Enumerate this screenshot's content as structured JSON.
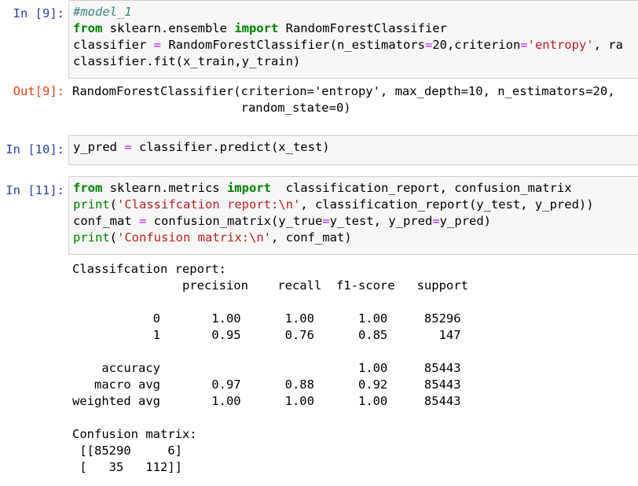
{
  "cells": [
    {
      "prompt": "In [9]:",
      "lines": [
        "#model_1",
        "from sklearn.ensemble import RandomForestClassifier",
        "classifier = RandomForestClassifier(n_estimators=20,criterion='entropy', ra",
        "classifier.fit(x_train,y_train)"
      ],
      "out_prompt": "Out[9]:",
      "output": "RandomForestClassifier(criterion='entropy', max_depth=10, n_estimators=20,\n                       random_state=0)"
    },
    {
      "prompt": "In [10]:",
      "lines": [
        "y_pred = classifier.predict(x_test)"
      ]
    },
    {
      "prompt": "In [11]:",
      "lines": [
        "from sklearn.metrics import  classification_report, confusion_matrix",
        "print('Classifcation report:\\n', classification_report(y_test, y_pred))",
        "conf_mat = confusion_matrix(y_true=y_test, y_pred=y_pred)",
        "print('Confusion matrix:\\n', conf_mat)"
      ],
      "stdout": "Classifcation report:\n               precision    recall  f1-score   support\n\n           0       1.00      1.00      1.00     85296\n           1       0.95      0.76      0.85       147\n\n    accuracy                           1.00     85443\n   macro avg       0.97      0.88      0.92     85443\nweighted avg       1.00      1.00      1.00     85443\n\nConfusion matrix:\n [[85290     6]\n [   35   112]]"
    }
  ]
}
